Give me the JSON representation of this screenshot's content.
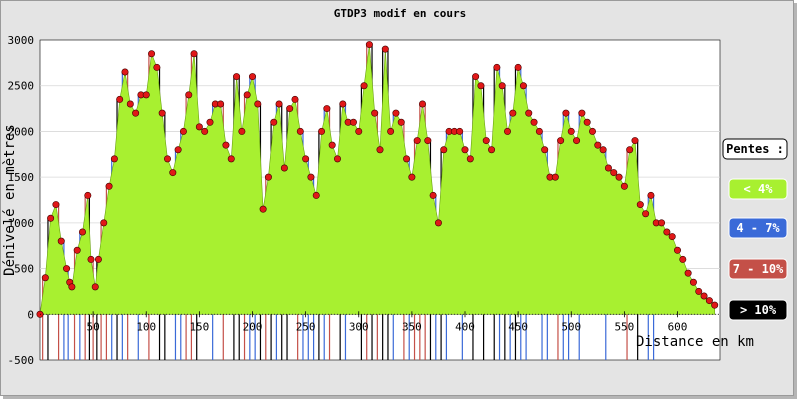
{
  "chart_data": {
    "type": "area",
    "title": "GTDP3 modif en cours",
    "xlabel": "Distance en km",
    "ylabel": "Dénivelé en mètres",
    "xlim": [
      0,
      640
    ],
    "ylim": [
      -500,
      3000
    ],
    "x_ticks": [
      50,
      100,
      150,
      200,
      250,
      300,
      350,
      400,
      450,
      500,
      550,
      600
    ],
    "y_ticks": [
      -500,
      0,
      500,
      1000,
      1500,
      2000,
      2500,
      3000
    ],
    "grid": true,
    "legend_placement": "right",
    "legend": {
      "title": "Pentes :",
      "items": [
        {
          "label": "< 4%",
          "color": "#a8f030"
        },
        {
          "label": "4 - 7%",
          "color": "#3a6ad8"
        },
        {
          "label": "7 - 10%",
          "color": "#c45048"
        },
        {
          "label": "> 10%",
          "color": "#000000"
        }
      ]
    },
    "series": [
      {
        "x": [
          0,
          5,
          10,
          15,
          20,
          25,
          28,
          30,
          35,
          40,
          45,
          48,
          52,
          55,
          60,
          65,
          70,
          75,
          80,
          85,
          90,
          95,
          100,
          105,
          110,
          115,
          120,
          125,
          130,
          135,
          140,
          145,
          150,
          155,
          160,
          165,
          170,
          175,
          180,
          185,
          190,
          195,
          200,
          205,
          210,
          215,
          220,
          225,
          230,
          235,
          240,
          245,
          250,
          255,
          260,
          265,
          270,
          275,
          280,
          285,
          290,
          295,
          300,
          305,
          310,
          315,
          320,
          325,
          330,
          335,
          340,
          345,
          350,
          355,
          360,
          365,
          370,
          375,
          380,
          385,
          390,
          395,
          400,
          405,
          410,
          415,
          420,
          425,
          430,
          435,
          440,
          445,
          450,
          455,
          460,
          465,
          470,
          475,
          480,
          485,
          490,
          495,
          500,
          505,
          510,
          515,
          520,
          525,
          530,
          535,
          540,
          545,
          550,
          555,
          560,
          565,
          570,
          575,
          580,
          585,
          590,
          595,
          600,
          605,
          610,
          615,
          620,
          625,
          630,
          635
        ],
        "y": [
          0,
          400,
          1050,
          1200,
          800,
          500,
          350,
          300,
          700,
          900,
          1300,
          600,
          300,
          600,
          1000,
          1400,
          1700,
          2350,
          2650,
          2300,
          2200,
          2400,
          2400,
          2850,
          2700,
          2200,
          1700,
          1550,
          1800,
          2000,
          2400,
          2850,
          2050,
          2000,
          2100,
          2300,
          2300,
          1850,
          1700,
          2600,
          2000,
          2400,
          2600,
          2300,
          1150,
          1500,
          2100,
          2300,
          1600,
          2250,
          2350,
          2000,
          1700,
          1500,
          1300,
          2000,
          2250,
          1850,
          1700,
          2300,
          2100,
          2100,
          2000,
          2500,
          2950,
          2200,
          1800,
          2900,
          2000,
          2200,
          2100,
          1700,
          1500,
          1900,
          2300,
          1900,
          1300,
          1000,
          1800,
          2000,
          2000,
          2000,
          1800,
          1700,
          2600,
          2500,
          1900,
          1800,
          2700,
          2500,
          2000,
          2200,
          2700,
          2500,
          2200,
          2100,
          2000,
          1800,
          1500,
          1500,
          1900,
          2200,
          2000,
          1900,
          2200,
          2100,
          2000,
          1850,
          1800,
          1600,
          1550,
          1500,
          1400,
          1800,
          1900,
          1200,
          1100,
          1300,
          1000,
          1000,
          900,
          850,
          700,
          600,
          450,
          350,
          250,
          200,
          150,
          100
        ]
      }
    ]
  }
}
